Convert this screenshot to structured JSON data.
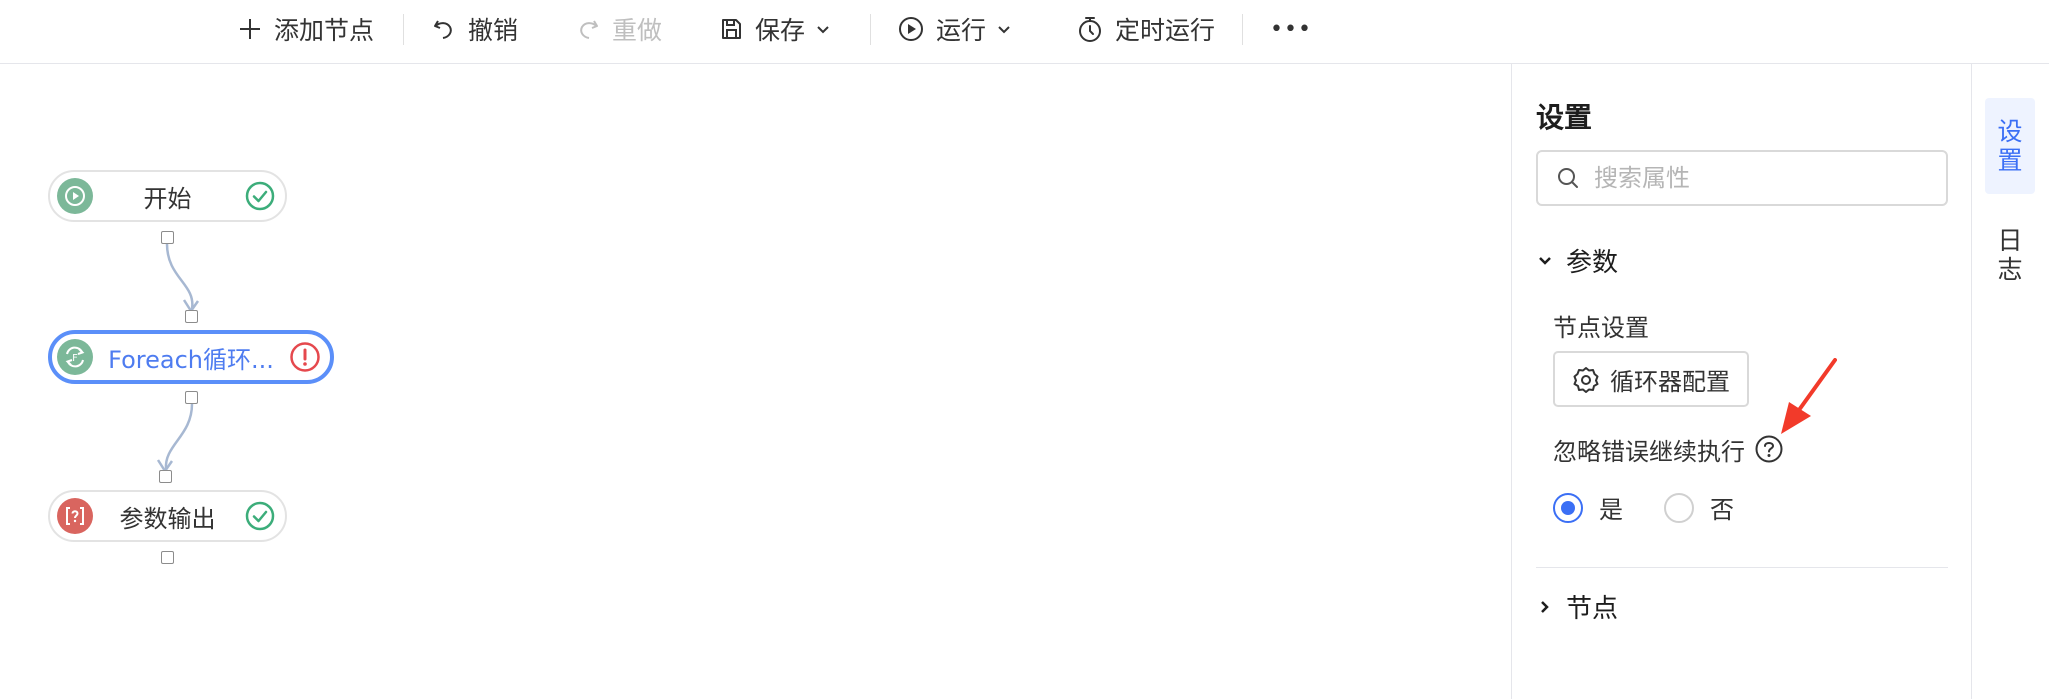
{
  "toolbar": {
    "add_node": "添加节点",
    "undo": "撤销",
    "redo": "重做",
    "save": "保存",
    "run": "运行",
    "schedule_run": "定时运行",
    "more": "•••"
  },
  "flow": {
    "nodes": [
      {
        "label": "开始",
        "status": "success"
      },
      {
        "label": "Foreach循环...",
        "status": "error"
      },
      {
        "label": "参数输出",
        "status": "success"
      }
    ]
  },
  "panel": {
    "title": "设置",
    "search_placeholder": "搜索属性",
    "section_params": "参数",
    "node_settings_label": "节点设置",
    "loop_config_button": "循环器配置",
    "ignore_error_label": "忽略错误继续执行",
    "radio_yes": "是",
    "radio_no": "否",
    "ignore_error_value": "是",
    "section_node": "节点"
  },
  "rail": {
    "tab_settings": [
      "设",
      "置"
    ],
    "tab_log": [
      "日",
      "志"
    ]
  },
  "colors": {
    "accent": "#3b6ff5",
    "node_selected_border": "#5b8ff9",
    "success": "#3cad7a",
    "error": "#e5484d",
    "annotation_arrow": "#f23a2a"
  }
}
